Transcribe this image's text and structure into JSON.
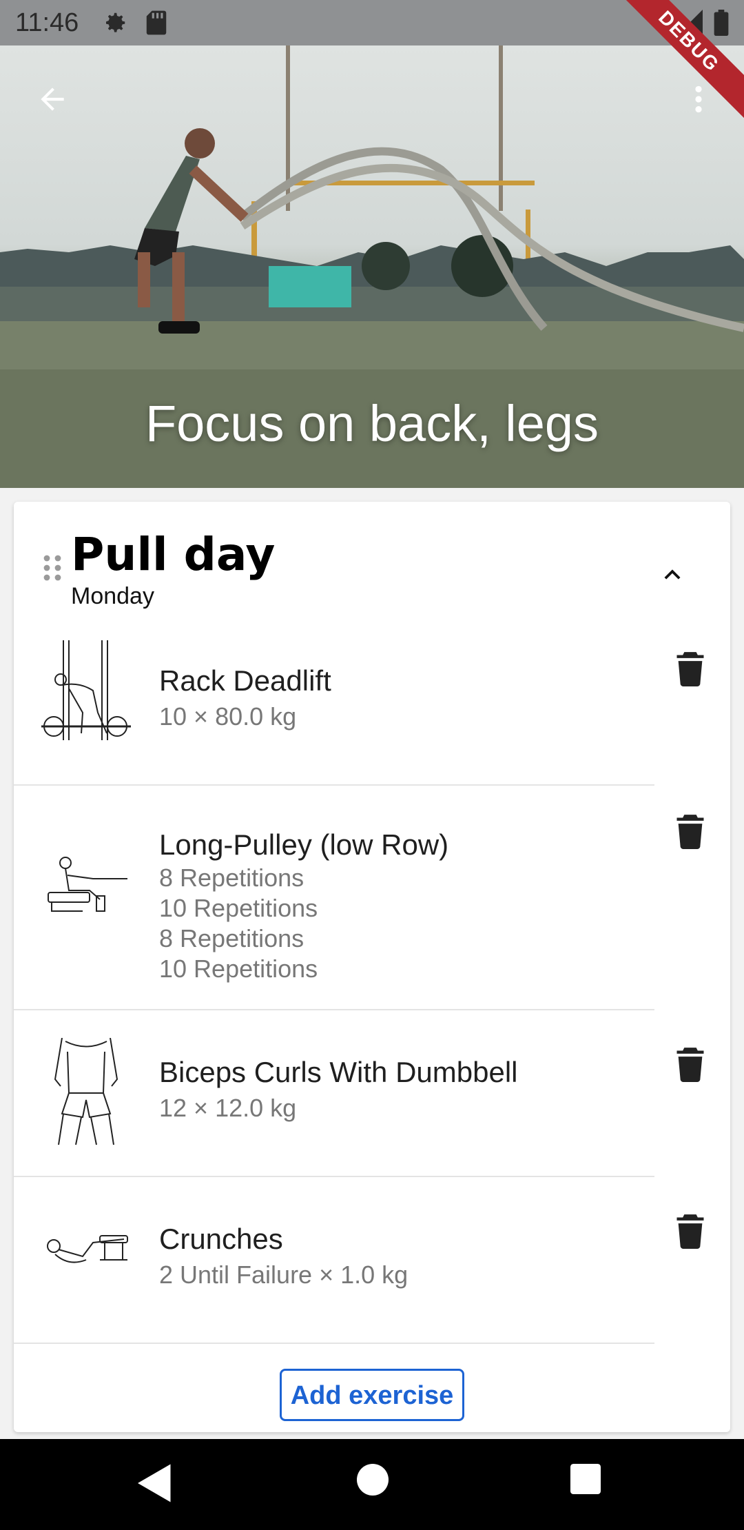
{
  "status_bar": {
    "time": "11:46",
    "icons": [
      "gear-icon",
      "sd-card-icon",
      "wifi-icon",
      "signal-icon",
      "battery-icon"
    ]
  },
  "debug_banner": "DEBUG",
  "hero": {
    "title": "Focus on back, legs",
    "back_icon": "arrow-left-icon",
    "menu_icon": "more-vert-icon"
  },
  "day": {
    "title": "Pull day",
    "subtitle": "Monday",
    "collapse_icon": "chevron-up-icon",
    "drag_icon": "drag-handle-icon"
  },
  "exercises": [
    {
      "name": "Rack Deadlift",
      "details": [
        "10 × 80.0 kg"
      ]
    },
    {
      "name": "Long-Pulley (low Row)",
      "details": [
        "8 Repetitions",
        "10 Repetitions",
        "8 Repetitions",
        "10 Repetitions"
      ]
    },
    {
      "name": "Biceps Curls With Dumbbell",
      "details": [
        "12 × 12.0 kg"
      ]
    },
    {
      "name": "Crunches",
      "details": [
        "2 Until Failure × 1.0 kg"
      ]
    }
  ],
  "add_exercise_label": "Add exercise",
  "colors": {
    "accent": "#1d63d3",
    "debug": "#b3262d",
    "status_bar": "#8f9193",
    "nav_bar": "#000000"
  }
}
